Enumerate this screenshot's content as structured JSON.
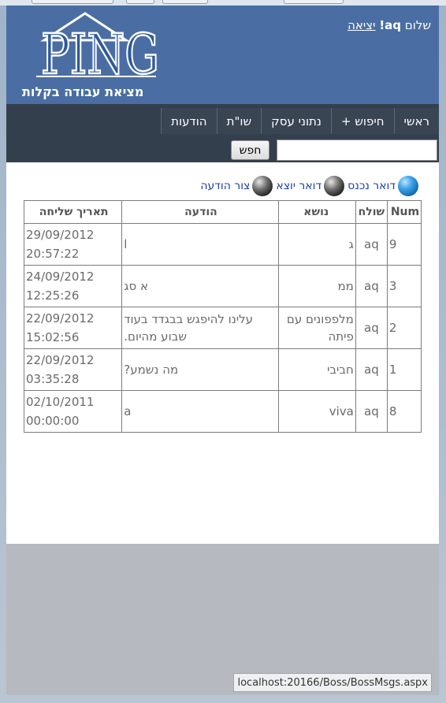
{
  "header": {
    "greeting_prefix": "שלום",
    "username": "aq",
    "exclaim": "!",
    "logout_label": "יציאה",
    "logo_text": "PING",
    "slogan": "מציאת עבודה בקלות"
  },
  "nav": {
    "items": [
      {
        "label": "ראשי"
      },
      {
        "label": "חיפוש +"
      },
      {
        "label": "נתוני עסק"
      },
      {
        "label": "שו\"ת"
      },
      {
        "label": "הודעות"
      }
    ]
  },
  "search": {
    "value": "",
    "button_label": "חפש"
  },
  "mail_links": [
    {
      "label": "דואר נכנס",
      "icon": "blue-orb-icon"
    },
    {
      "label": "דואר יוצא",
      "icon": "gray-orb-icon"
    },
    {
      "label": "צור הודעה",
      "icon": "gray-orb-icon"
    }
  ],
  "table": {
    "headers": {
      "num": "Num",
      "sender": "שולח",
      "subject": "נושא",
      "message": "הודעה",
      "date": "תאריך שליחה"
    },
    "rows": [
      {
        "num": "9",
        "sender": "aq",
        "subject": "ג",
        "message": "l",
        "date": "29/09/2012 20:57:22"
      },
      {
        "num": "3",
        "sender": "aq",
        "subject": "ממ",
        "message": "א סג",
        "date": "24/09/2012 12:25:26"
      },
      {
        "num": "2",
        "sender": "aq",
        "subject": "מלפפונים עם פיתה",
        "message": "עלינו להיפגש בבגדד בעוד שבוע מהיום.",
        "date": "22/09/2012 15:02:56"
      },
      {
        "num": "1",
        "sender": "aq",
        "subject": "חביבי",
        "message": "מה נשמע?",
        "date": "22/09/2012 03:35:28"
      },
      {
        "num": "8",
        "sender": "aq",
        "subject": "viva",
        "message": "a",
        "date": "02/10/2011 00:00:00"
      }
    ]
  },
  "status_bar": {
    "url": "localhost:20166/Boss/BossMsgs.aspx"
  },
  "colors": {
    "header_bg": "#4a6ea3",
    "nav_bg": "#343f4d",
    "link_color": "#1f3fa8"
  }
}
